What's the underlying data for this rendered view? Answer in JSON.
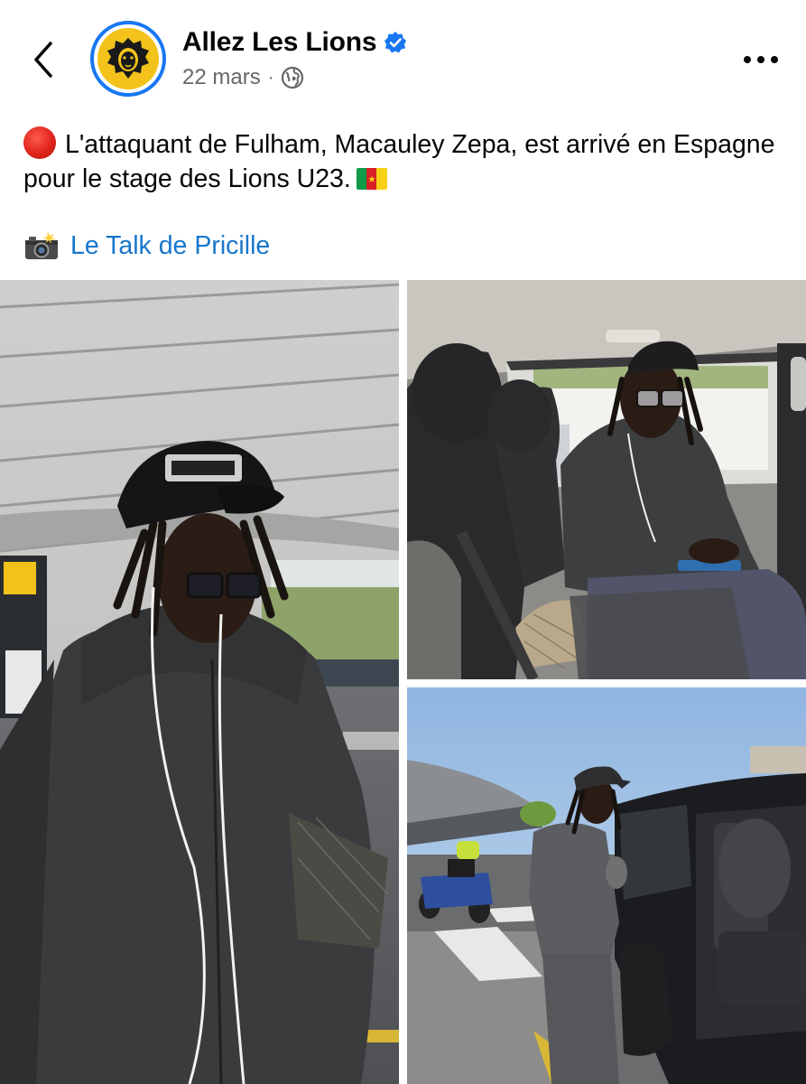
{
  "header": {
    "page_name": "Allez Les Lions",
    "date": "22 mars",
    "separator": "·"
  },
  "post": {
    "line1": "L'attaquant de Fulham, Macauley Zepa, est arrivé en Espagne pour le stage des Lions U23.",
    "credit": "Le Talk de Pricille"
  },
  "icons": {
    "back": "chevron-left-icon",
    "verified": "verified-badge-icon",
    "audience": "globe-icon",
    "more": "more-horizontal-icon",
    "status": "red-circle-icon",
    "flag": "cameroon-flag-icon",
    "camera": "camera-flash-icon"
  },
  "colors": {
    "accent": "#1877f2",
    "link": "#1876cc",
    "meta": "#65676b",
    "avatar_bg": "#f3c31b"
  }
}
